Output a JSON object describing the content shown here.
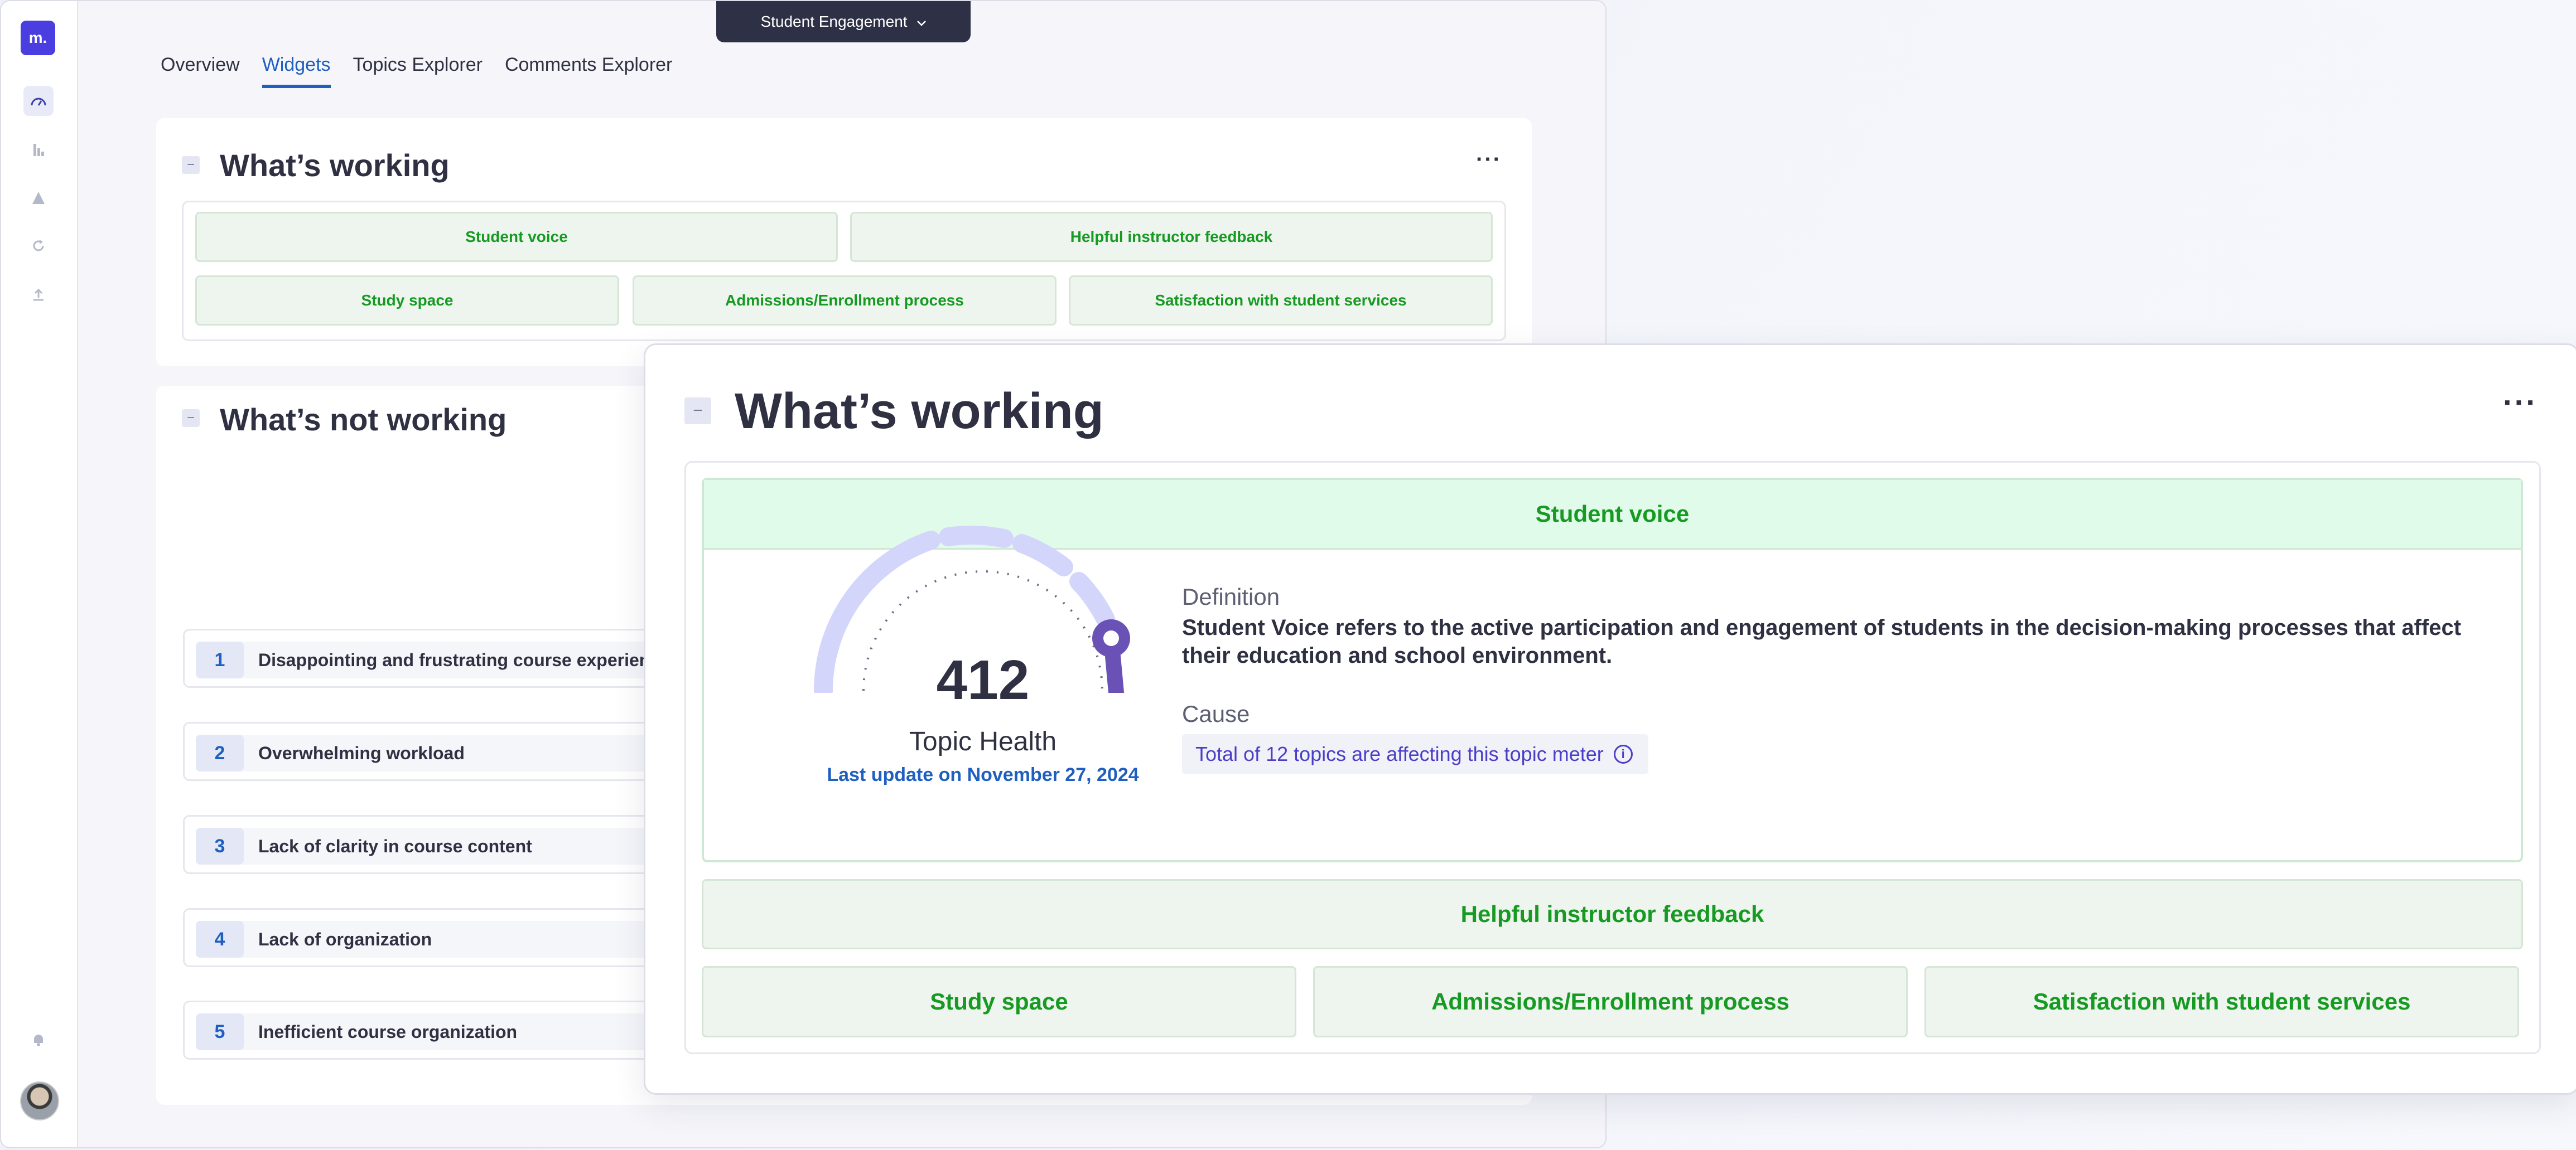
{
  "app": {
    "dashboard_selector": "Student Engagement",
    "tabs": [
      "Overview",
      "Widgets",
      "Topics Explorer",
      "Comments Explorer"
    ],
    "active_tab": "Widgets",
    "logo_text": "m."
  },
  "sidebar": {
    "icons": [
      "dashboard-icon",
      "bar-chart-icon",
      "hierarchy-icon",
      "refresh-icon",
      "upload-icon",
      "bell-icon"
    ]
  },
  "working_card": {
    "title": "What’s working",
    "menu": "···",
    "topics": [
      "Student voice",
      "Helpful instructor feedback",
      "Study space",
      "Admissions/Enrollment process",
      "Satisfaction with student services"
    ]
  },
  "not_working_card": {
    "title": "What’s not working",
    "items": [
      {
        "rank": "1",
        "label": "Disappointing and frustrating course experien"
      },
      {
        "rank": "2",
        "label": "Overwhelming workload"
      },
      {
        "rank": "3",
        "label": "Lack of clarity in course content"
      },
      {
        "rank": "4",
        "label": "Lack of organization"
      },
      {
        "rank": "5",
        "label": "Inefficient course organization"
      }
    ]
  },
  "popup": {
    "title": "What’s working",
    "menu": "···",
    "expanded_topic": "Student voice",
    "gauge": {
      "value": "412",
      "caption": "Topic Health",
      "last_update": "Last update on November 27, 2024"
    },
    "definition_label": "Definition",
    "definition_text": "Student Voice refers to the active participation and engagement of students in the decision-making processes that affect their education and school environment.",
    "cause_label": "Cause",
    "cause_text": "Total of 12 topics are affecting this topic meter",
    "other_topics": [
      "Helpful instructor feedback",
      "Study space",
      "Admissions/Enrollment process",
      "Satisfaction with student services"
    ]
  }
}
